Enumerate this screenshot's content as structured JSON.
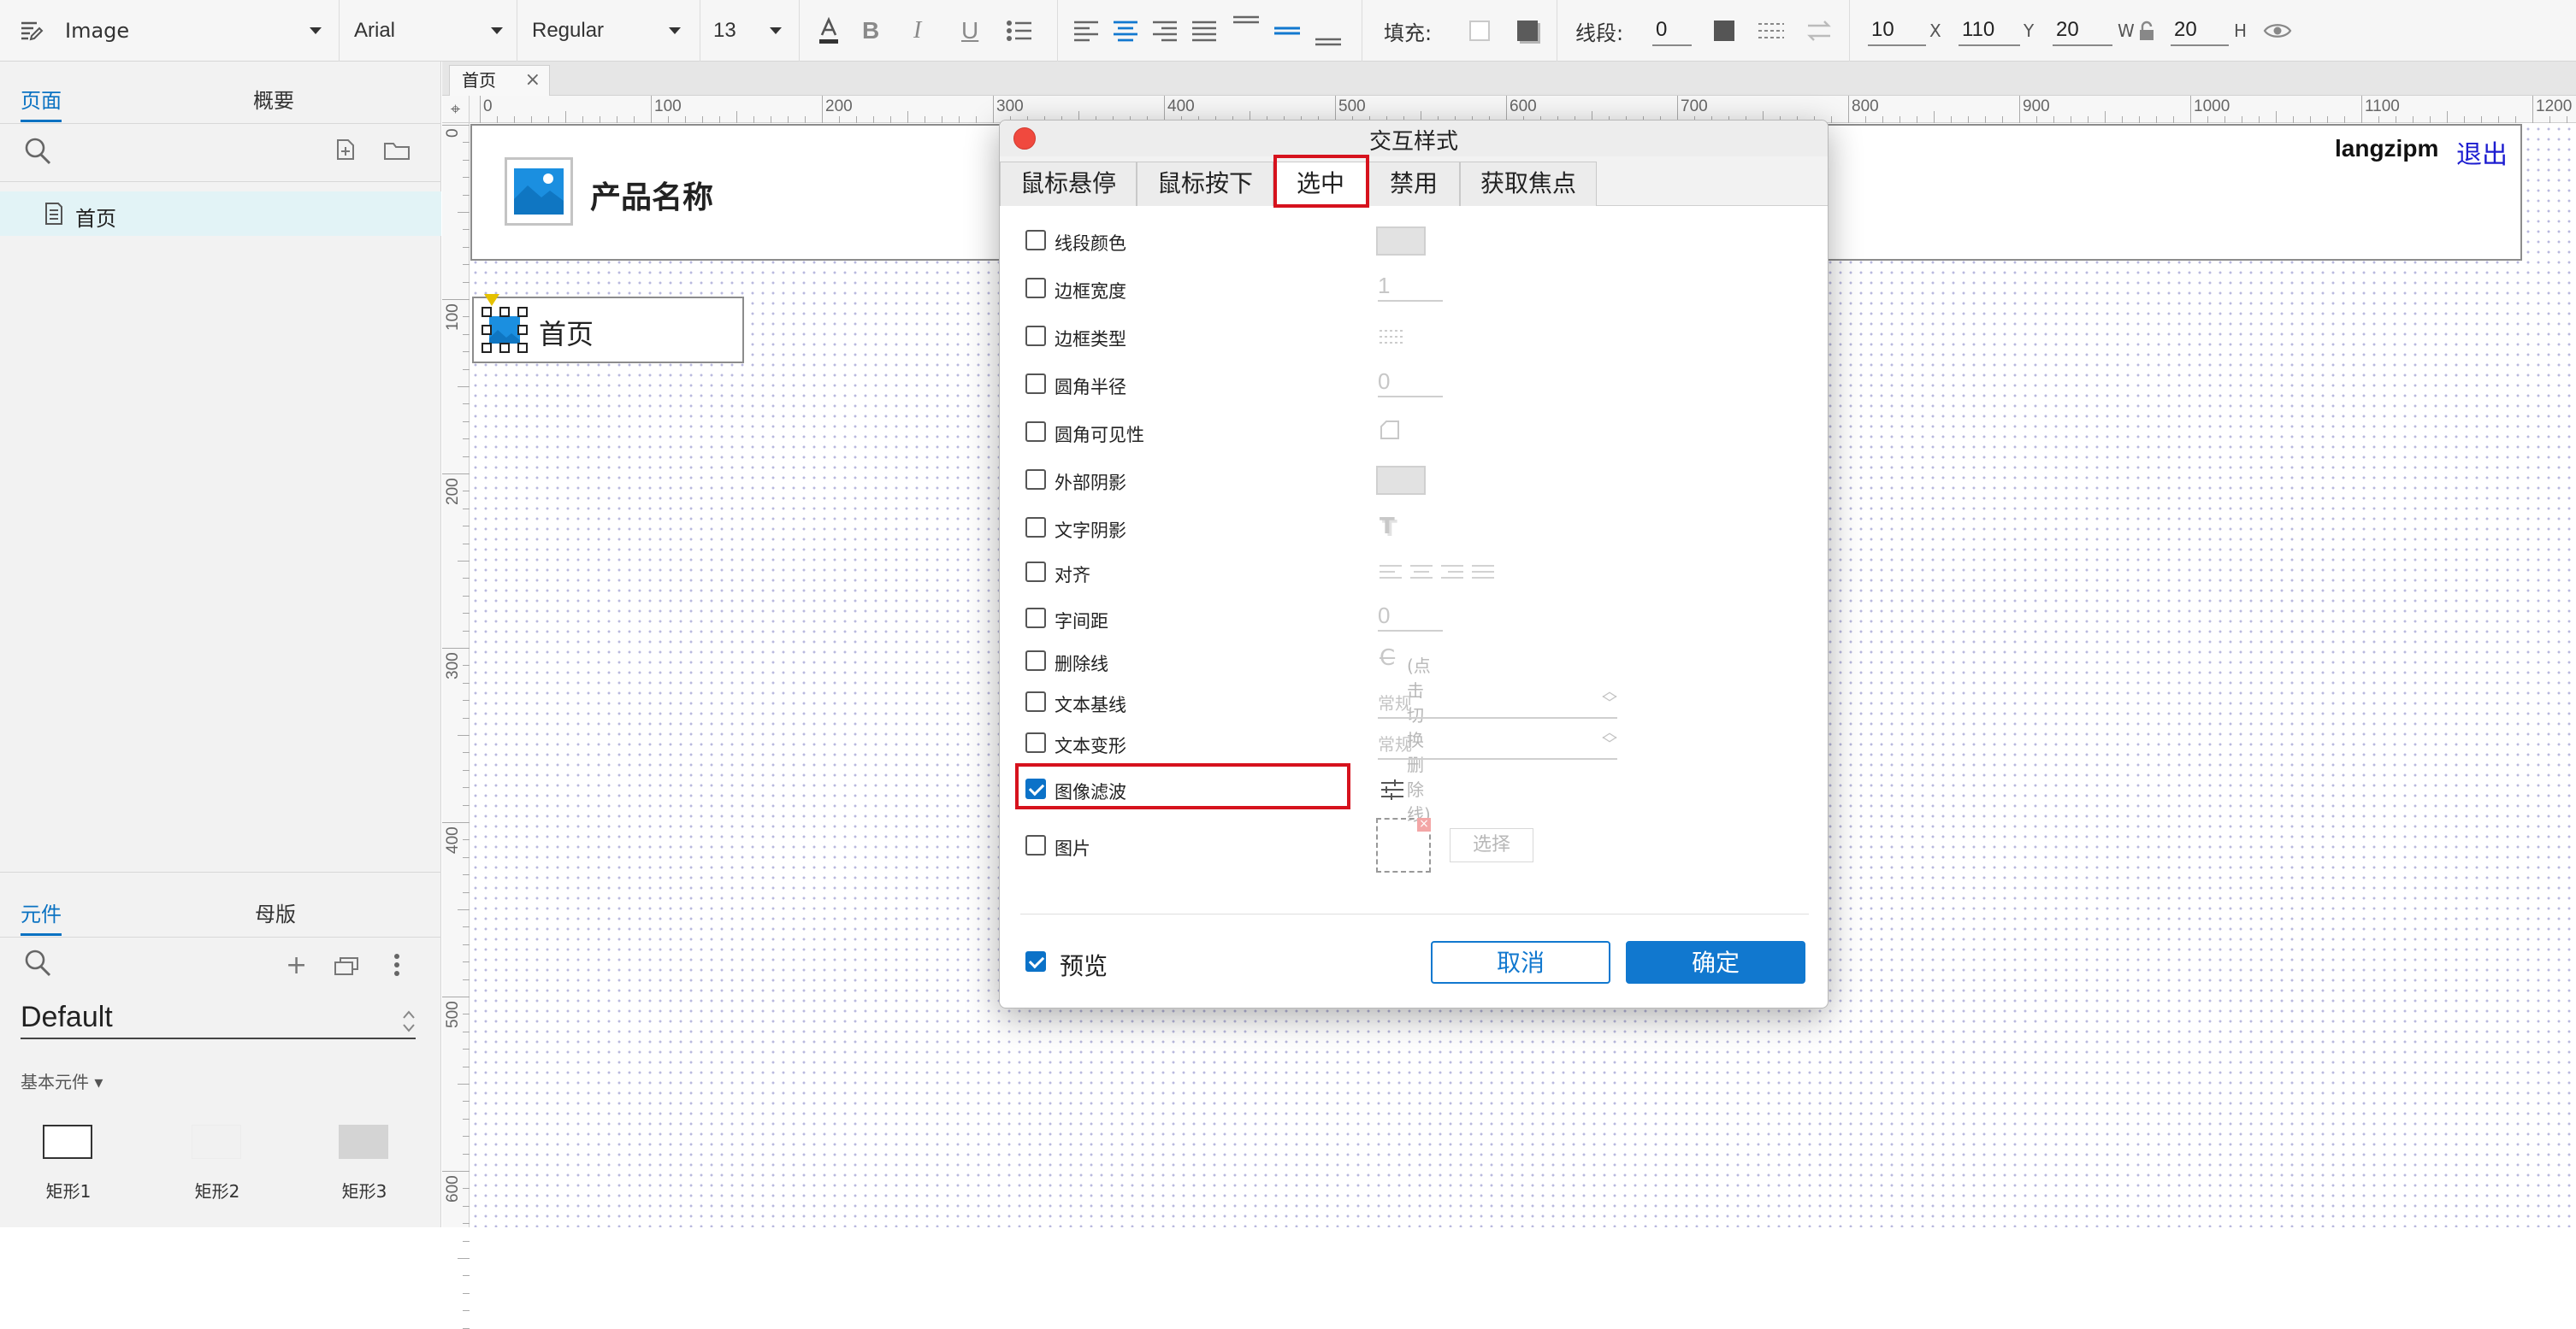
{
  "toolbar": {
    "element_type": "Image",
    "font_family": "Arial",
    "font_weight": "Regular",
    "font_size": "13",
    "fill_label": "填充:",
    "stroke_label": "线段:",
    "stroke_value": "0",
    "x_value": "10",
    "x_axis": "X",
    "y_value": "110",
    "y_axis": "Y",
    "w_value": "20",
    "w_axis": "W",
    "h_value": "20",
    "h_axis": "H"
  },
  "left_panel": {
    "tabs": [
      "页面",
      "概要"
    ],
    "pages": [
      {
        "label": "首页"
      }
    ],
    "library_tabs": [
      "元件",
      "母版"
    ],
    "library": "Default",
    "category": "基本元件 ▾",
    "elements": [
      {
        "label": "矩形1"
      },
      {
        "label": "矩形2"
      },
      {
        "label": "矩形3"
      }
    ]
  },
  "canvas": {
    "doc_tab": "首页",
    "ruler_h": [
      "0",
      "100",
      "200",
      "300",
      "400",
      "500",
      "600",
      "700",
      "800",
      "900",
      "1000",
      "1100",
      "1200"
    ],
    "ruler_v": [
      "0",
      "100",
      "200",
      "300",
      "400",
      "500",
      "600"
    ],
    "header": {
      "product_name": "产品名称",
      "username": "langzipm",
      "logout": "退出"
    },
    "menu": {
      "label": "首页"
    }
  },
  "dialog": {
    "title": "交互样式",
    "tabs": [
      "鼠标悬停",
      "鼠标按下",
      "选中",
      "禁用",
      "获取焦点"
    ],
    "active_tab": "选中",
    "properties": [
      {
        "label": "线段颜色",
        "checked": false
      },
      {
        "label": "边框宽度",
        "checked": false,
        "value": "1"
      },
      {
        "label": "边框类型",
        "checked": false
      },
      {
        "label": "圆角半径",
        "checked": false,
        "value": "0"
      },
      {
        "label": "圆角可见性",
        "checked": false
      },
      {
        "label": "外部阴影",
        "checked": false
      },
      {
        "label": "文字阴影",
        "checked": false
      },
      {
        "label": "对齐",
        "checked": false
      },
      {
        "label": "字间距",
        "checked": false,
        "value": "0"
      },
      {
        "label": "删除线",
        "checked": false,
        "hint": "(点击切换删除线)"
      },
      {
        "label": "文本基线",
        "checked": false,
        "value": "常规"
      },
      {
        "label": "文本变形",
        "checked": false,
        "value": "常规"
      },
      {
        "label": "图像滤波",
        "checked": true
      },
      {
        "label": "图片",
        "checked": false,
        "button": "选择"
      }
    ],
    "preview_label": "预览",
    "cancel_label": "取消",
    "ok_label": "确定"
  }
}
